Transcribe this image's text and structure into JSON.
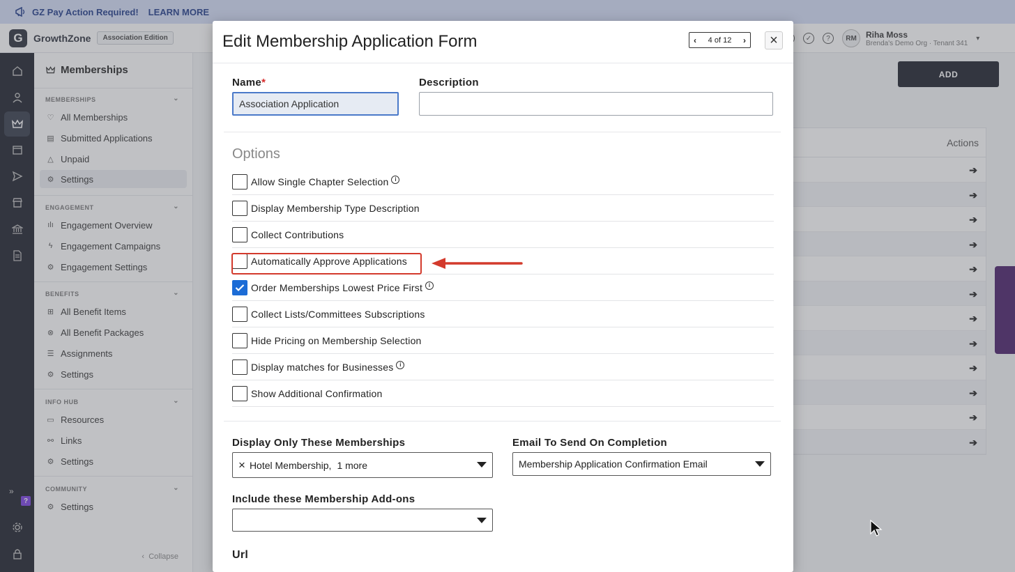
{
  "banner": {
    "text": "GZ Pay Action Required!",
    "link": "LEARN MORE"
  },
  "topbar": {
    "brand": "GrowthZone",
    "edition": "Association Edition",
    "user": {
      "initials": "RM",
      "name": "Riha Moss",
      "org": "Brenda's Demo Org · Tenant 341"
    }
  },
  "sidebar": {
    "title": "Memberships",
    "sections": [
      {
        "label": "MEMBERSHIPS",
        "items": [
          "All Memberships",
          "Submitted Applications",
          "Unpaid",
          "Settings"
        ]
      },
      {
        "label": "ENGAGEMENT",
        "items": [
          "Engagement Overview",
          "Engagement Campaigns",
          "Engagement Settings"
        ]
      },
      {
        "label": "BENEFITS",
        "items": [
          "All Benefit Items",
          "All Benefit Packages",
          "Assignments",
          "Settings"
        ]
      },
      {
        "label": "INFO HUB",
        "items": [
          "Resources",
          "Links",
          "Settings"
        ]
      },
      {
        "label": "COMMUNITY",
        "items": [
          "Settings"
        ]
      }
    ],
    "collapse": "Collapse"
  },
  "main": {
    "add_button": "ADD",
    "actions_header": "Actions"
  },
  "modal": {
    "title": "Edit Membership Application Form",
    "pager": "4 of 12",
    "name_label": "Name",
    "name_value": "Association Application",
    "description_label": "Description",
    "description_value": "",
    "options_title": "Options",
    "options": [
      {
        "label": "Allow Single Chapter Selection",
        "checked": false,
        "info": true
      },
      {
        "label": "Display Membership Type Description",
        "checked": false,
        "info": false
      },
      {
        "label": "Collect Contributions",
        "checked": false,
        "info": false
      },
      {
        "label": "Automatically Approve Applications",
        "checked": false,
        "info": false
      },
      {
        "label": "Order Memberships Lowest Price First",
        "checked": true,
        "info": true
      },
      {
        "label": "Collect Lists/Committees Subscriptions",
        "checked": false,
        "info": false
      },
      {
        "label": "Hide Pricing on Membership Selection",
        "checked": false,
        "info": false
      },
      {
        "label": "Display matches for Businesses",
        "checked": false,
        "info": true
      },
      {
        "label": "Show Additional Confirmation",
        "checked": false,
        "info": false
      }
    ],
    "display_only_label": "Display Only These Memberships",
    "display_only_value": "Hotel Membership,",
    "display_only_more": "1 more",
    "email_label": "Email To Send On Completion",
    "email_value": "Membership Application Confirmation Email",
    "addons_label": "Include these Membership Add-ons",
    "addons_value": "",
    "url_label": "Url"
  },
  "colors": {
    "accent": "#1c6cd6",
    "highlight": "#d33a2c",
    "dark": "#1c1f2a"
  }
}
